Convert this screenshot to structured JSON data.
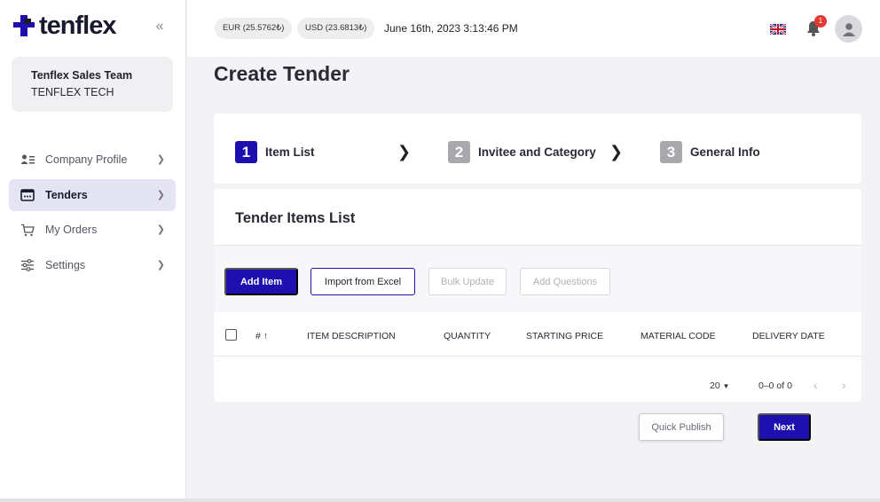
{
  "brand": {
    "name": "tenflex",
    "color": "#1e10b0"
  },
  "sidebar": {
    "collapse_icon": "double-chevron-left-icon",
    "team": {
      "name": "Tenflex Sales Team",
      "company": "TENFLEX TECH"
    },
    "items": [
      {
        "label": "Company Profile",
        "icon": "company-profile-icon",
        "active": false
      },
      {
        "label": "Tenders",
        "icon": "tenders-icon",
        "active": true
      },
      {
        "label": "My Orders",
        "icon": "cart-icon",
        "active": false
      },
      {
        "label": "Settings",
        "icon": "sliders-icon",
        "active": false
      }
    ]
  },
  "topbar": {
    "eur_rate": "EUR (25.5762₺)",
    "usd_rate": "USD (23.6813₺)",
    "datetime": "June 16th, 2023 3:13:46 PM",
    "notification_count": "1"
  },
  "page": {
    "title": "Create Tender"
  },
  "steps": [
    {
      "number": "1",
      "label": "Item List",
      "active": true
    },
    {
      "number": "2",
      "label": "Invitee and Category",
      "active": false
    },
    {
      "number": "3",
      "label": "General Info",
      "active": false
    }
  ],
  "items_list": {
    "title": "Tender Items List",
    "buttons": {
      "add_item": "Add Item",
      "import_excel": "Import from Excel",
      "bulk_update": "Bulk Update",
      "add_questions": "Add Questions"
    },
    "columns": [
      "#",
      "ITEM DESCRIPTION",
      "QUANTITY",
      "STARTING PRICE",
      "MATERIAL CODE",
      "DELIVERY DATE"
    ],
    "pagination": {
      "page_size": "20",
      "range": "0–0 of 0"
    }
  },
  "actions": {
    "quick_publish": "Quick Publish",
    "next": "Next"
  }
}
